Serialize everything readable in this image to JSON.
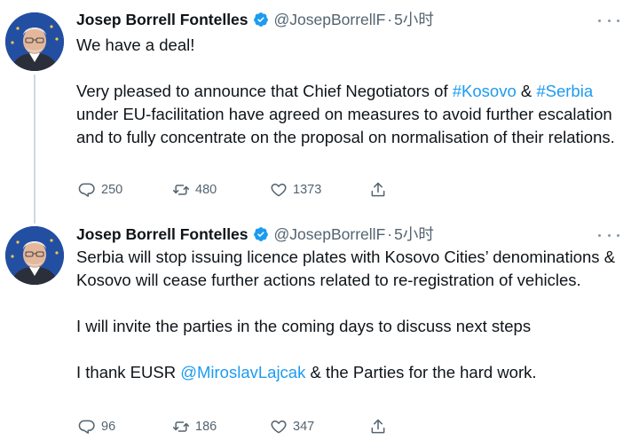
{
  "tweets": [
    {
      "author": "Josep Borrell Fontelles",
      "handle": "@JosepBorrellF",
      "separator": "·",
      "time": "5小时",
      "line1": "We have a deal!",
      "p2_pre": "Very pleased to announce that Chief Negotiators of ",
      "tag_kosovo": "#Kosovo",
      "amp": " & ",
      "tag_serbia": "#Serbia",
      "p2_post": " under EU-facilitation have agreed on measures to avoid further escalation and to fully concentrate on the proposal on normalisation of their relations.",
      "replies": "250",
      "retweets": "480",
      "likes": "1373"
    },
    {
      "author": "Josep Borrell Fontelles",
      "handle": "@JosepBorrellF",
      "separator": "·",
      "time": "5小时",
      "p1": "Serbia will stop issuing licence plates with Kosovo Cities’ denominations & Kosovo will cease further actions related to re-registration of vehicles.",
      "p2": "I will invite the parties in the coming days to discuss next steps",
      "p3_pre": "I thank EUSR ",
      "mention": "@MiroslavLajcak",
      "p3_post": " & the Parties for the hard work.",
      "replies": "96",
      "retweets": "186",
      "likes": "347"
    }
  ],
  "icons": {
    "avatar": "avatar-portrait",
    "verified": "verified-badge-icon",
    "more": "more-options-icon",
    "reply": "reply-icon",
    "retweet": "retweet-icon",
    "like": "like-heart-icon",
    "share": "share-icon"
  },
  "colors": {
    "link": "#1d9bf0",
    "verified": "#1d9bf0",
    "secondary_text": "#536471",
    "thread_line": "#cfd9de"
  }
}
